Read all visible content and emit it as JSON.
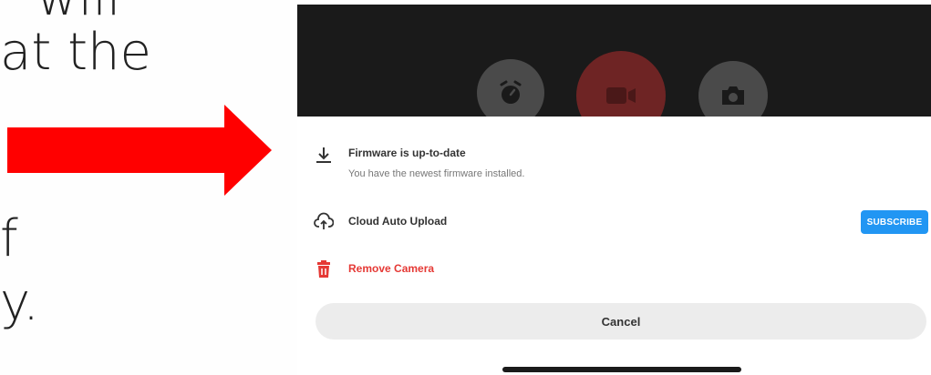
{
  "slide": {
    "line1": "will",
    "line2": "at the",
    "line3": "f",
    "line4": "y."
  },
  "colors": {
    "arrow": "#ff0000",
    "accent_blue": "#2196f3",
    "danger_red": "#e53935",
    "camera_bar": "#1a1a1a"
  },
  "camera_controls": {
    "icons": [
      "timer-icon",
      "video-camera-icon",
      "camera-icon"
    ]
  },
  "sheet": {
    "firmware": {
      "icon": "download-icon",
      "title": "Firmware is up-to-date",
      "subtitle": "You have the newest firmware installed."
    },
    "cloud": {
      "icon": "cloud-upload-icon",
      "title": "Cloud Auto Upload",
      "button": "SUBSCRIBE"
    },
    "remove": {
      "icon": "trash-icon",
      "title": "Remove Camera"
    },
    "cancel_label": "Cancel"
  }
}
